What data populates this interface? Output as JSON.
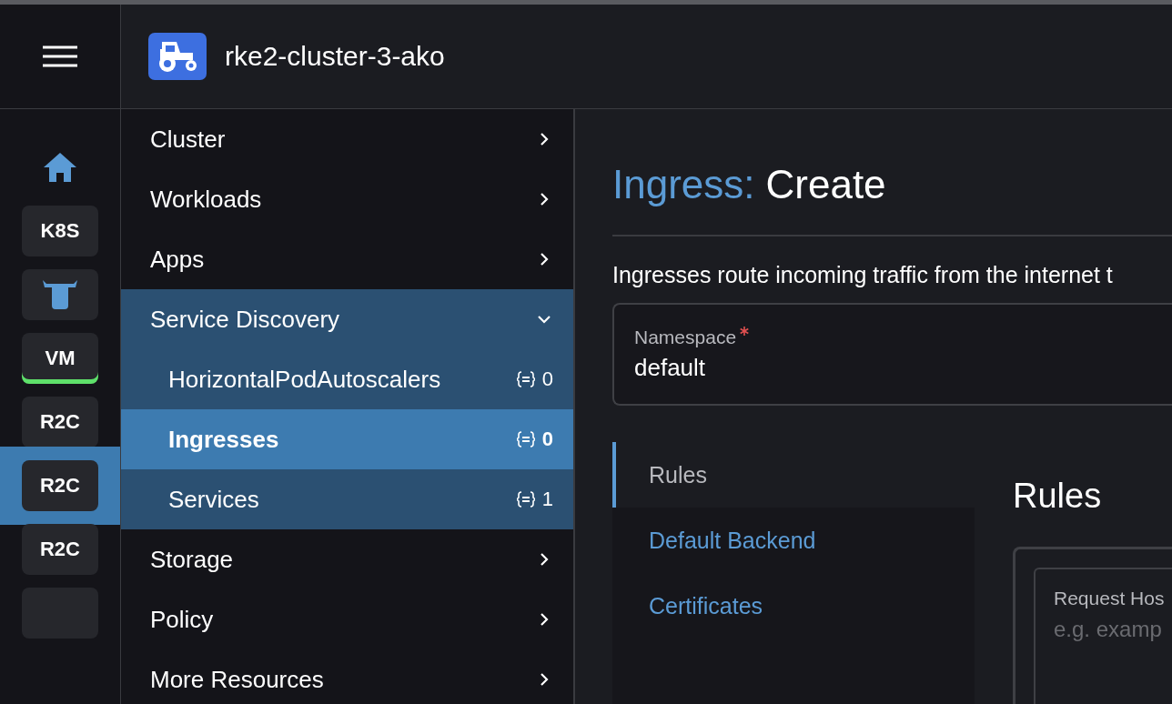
{
  "header": {
    "cluster_name": "rke2-cluster-3-ako"
  },
  "rail": [
    {
      "kind": "home",
      "selected": false,
      "active": false
    },
    {
      "kind": "text",
      "label": "K8S",
      "selected": false,
      "active": false
    },
    {
      "kind": "bull",
      "selected": false,
      "active": false
    },
    {
      "kind": "text",
      "label": "VM",
      "selected": false,
      "active": true
    },
    {
      "kind": "text",
      "label": "R2C",
      "selected": false,
      "active": false
    },
    {
      "kind": "text",
      "label": "R2C",
      "selected": true,
      "active": false
    },
    {
      "kind": "text",
      "label": "R2C",
      "selected": false,
      "active": false
    },
    {
      "kind": "blank",
      "selected": false,
      "active": false
    }
  ],
  "nav": [
    {
      "label": "Cluster",
      "expanded": false
    },
    {
      "label": "Workloads",
      "expanded": false
    },
    {
      "label": "Apps",
      "expanded": false
    },
    {
      "label": "Service Discovery",
      "expanded": true,
      "children": [
        {
          "label": "HorizontalPodAutoscalers",
          "count": "0",
          "selected": false
        },
        {
          "label": "Ingresses",
          "count": "0",
          "selected": true
        },
        {
          "label": "Services",
          "count": "1",
          "selected": false
        }
      ]
    },
    {
      "label": "Storage",
      "expanded": false
    },
    {
      "label": "Policy",
      "expanded": false
    },
    {
      "label": "More Resources",
      "expanded": false
    }
  ],
  "main": {
    "title_prefix": "Ingress:",
    "title": "Create",
    "description": "Ingresses route incoming traffic from the internet t",
    "namespace": {
      "label": "Namespace",
      "required": true,
      "value": "default"
    },
    "tabs": [
      {
        "label": "Rules",
        "selected": true
      },
      {
        "label": "Default Backend",
        "selected": false
      },
      {
        "label": "Certificates",
        "selected": false
      }
    ],
    "section_title": "Rules",
    "rule": {
      "label": "Request Hos",
      "placeholder": "e.g. examp"
    }
  }
}
